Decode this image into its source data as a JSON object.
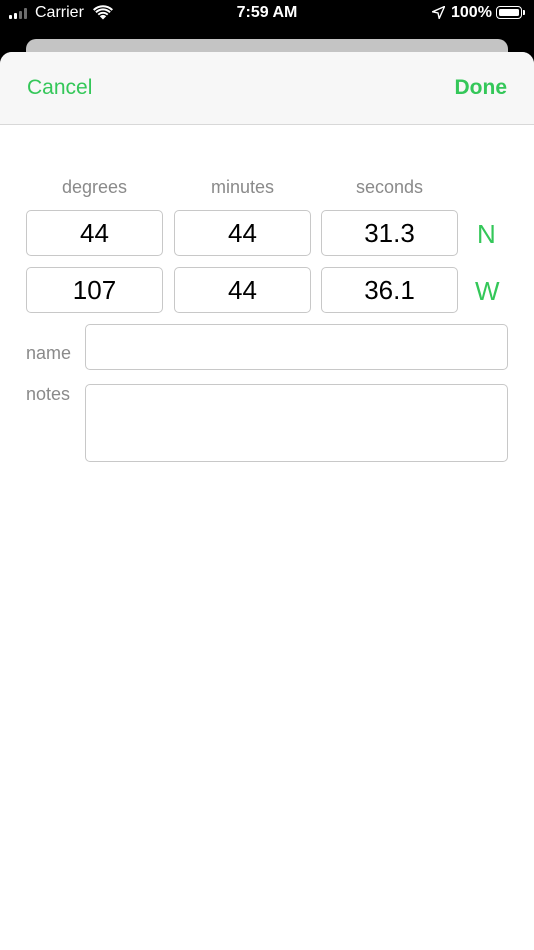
{
  "status_bar": {
    "carrier": "Carrier",
    "time": "7:59 AM",
    "battery": "100%"
  },
  "nav": {
    "cancel_label": "Cancel",
    "done_label": "Done"
  },
  "coordinates": {
    "headers": [
      "degrees",
      "minutes",
      "seconds"
    ],
    "latitude": {
      "degrees": "44",
      "minutes": "44",
      "seconds": "31.3",
      "hemisphere": "N"
    },
    "longitude": {
      "degrees": "107",
      "minutes": "44",
      "seconds": "36.1",
      "hemisphere": "W"
    }
  },
  "form": {
    "name_label": "name",
    "name_value": "",
    "notes_label": "notes",
    "notes_value": ""
  },
  "colors": {
    "accent": "#34c759"
  },
  "icons": [
    "signal-icon",
    "wifi-icon",
    "location-arrow-icon",
    "battery-icon"
  ]
}
